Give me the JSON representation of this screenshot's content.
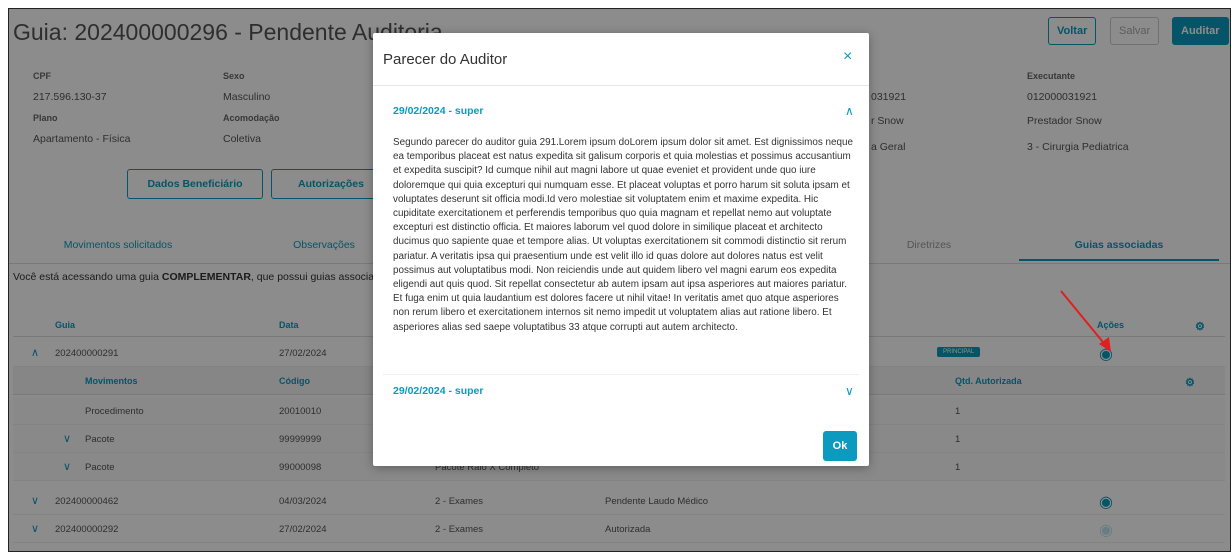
{
  "header": {
    "title": "Guia: 202400000296 - Pendente Auditoria",
    "buttons": {
      "voltar": "Voltar",
      "salvar": "Salvar",
      "auditar": "Auditar"
    }
  },
  "info": {
    "cpf_label": "CPF",
    "cpf": "217.596.130-37",
    "sexo_label": "Sexo",
    "sexo": "Masculino",
    "plano_label": "Plano",
    "plano": "Apartamento - Física",
    "acomodacao_label": "Acomodação",
    "acomodacao": "Coletiva",
    "col3_1": "031921",
    "col3_2": "r Snow",
    "col3_3": "a Geral",
    "executante_label": "Executante",
    "executante": "012000031921",
    "prestador": "Prestador Snow",
    "especialidade": "3 - Cirurgia Pediatrica"
  },
  "actions": {
    "dados_beneficiario": "Dados Beneficiário",
    "autorizacoes": "Autorizações"
  },
  "tabs": {
    "movimentos": "Movimentos solicitados",
    "observacoes": "Observações",
    "diretrizes": "Diretrizes",
    "guias_associadas": "Guias associadas"
  },
  "notice": {
    "prefix": "Você está acessando uma guia ",
    "bold": "COMPLEMENTAR",
    "suffix": ", que possui guias associa"
  },
  "grid": {
    "headers": {
      "guia": "Guia",
      "data": "Data",
      "acoes": "Ações"
    },
    "rows": [
      {
        "guia": "202400000291",
        "data": "27/02/2024",
        "badge": "PRINCIPAL"
      },
      {
        "guia": "202400000462",
        "data": "04/03/2024",
        "tipo": "2 - Exames",
        "status": "Pendente Laudo Médico"
      },
      {
        "guia": "202400000292",
        "data": "27/02/2024",
        "tipo": "2 - Exames",
        "status": "Autorizada"
      }
    ],
    "sub_headers": {
      "movimentos": "Movimentos",
      "codigo": "Código",
      "qtd": "Qtd. Autorizada"
    },
    "sub_rows": [
      {
        "mov": "Procedimento",
        "codigo": "20010010",
        "qtd": "1"
      },
      {
        "mov": "Pacote",
        "codigo": "99999999",
        "qtd": "1"
      },
      {
        "mov": "Pacote",
        "codigo": "99000098",
        "desc": "Pacote Raio X Completo",
        "qtd": "1"
      }
    ]
  },
  "modal": {
    "title": "Parecer do Auditor",
    "close": "×",
    "entry1_title": "29/02/2024 - super",
    "entry1_text": "Segundo parecer do auditor guia 291.Lorem ipsum doLorem ipsum dolor sit amet. Est dignissimos neque ea temporibus placeat est natus expedita sit galisum corporis et quia molestias et possimus accusantium et expedita suscipit? Id cumque nihil aut magni labore ut quae eveniet et provident unde quo iure doloremque qui quia excepturi qui numquam esse. Et placeat voluptas et porro harum sit soluta ipsam et voluptates deserunt sit officia modi.Id vero molestiae sit voluptatem enim et maxime expedita. Hic cupiditate exercitationem et perferendis temporibus quo quia magnam et repellat nemo aut voluptate excepturi est distinctio officia. Et maiores laborum vel quod dolore in similique placeat et architecto ducimus quo sapiente quae et tempore alias. Ut voluptas exercitationem sit commodi distinctio sit rerum pariatur. A veritatis ipsa qui praesentium unde est velit illo id quas dolore aut dolores natus est velit possimus aut voluptatibus modi. Non reiciendis unde aut quidem libero vel magni earum eos expedita eligendi aut quis quod. Sit repellat consectetur ab autem ipsam aut ipsa asperiores aut maiores pariatur. Et fuga enim ut quia laudantium est dolores facere ut nihil vitae! In veritatis amet quo atque asperiores non rerum libero et exercitationem internos sit nemo impedit ut voluptatem alias aut ratione libero. Et asperiores alias sed saepe voluptatibus 33 atque corrupti aut autem architecto.",
    "entry2_title": "29/02/2024 - super",
    "ok": "Ok"
  }
}
